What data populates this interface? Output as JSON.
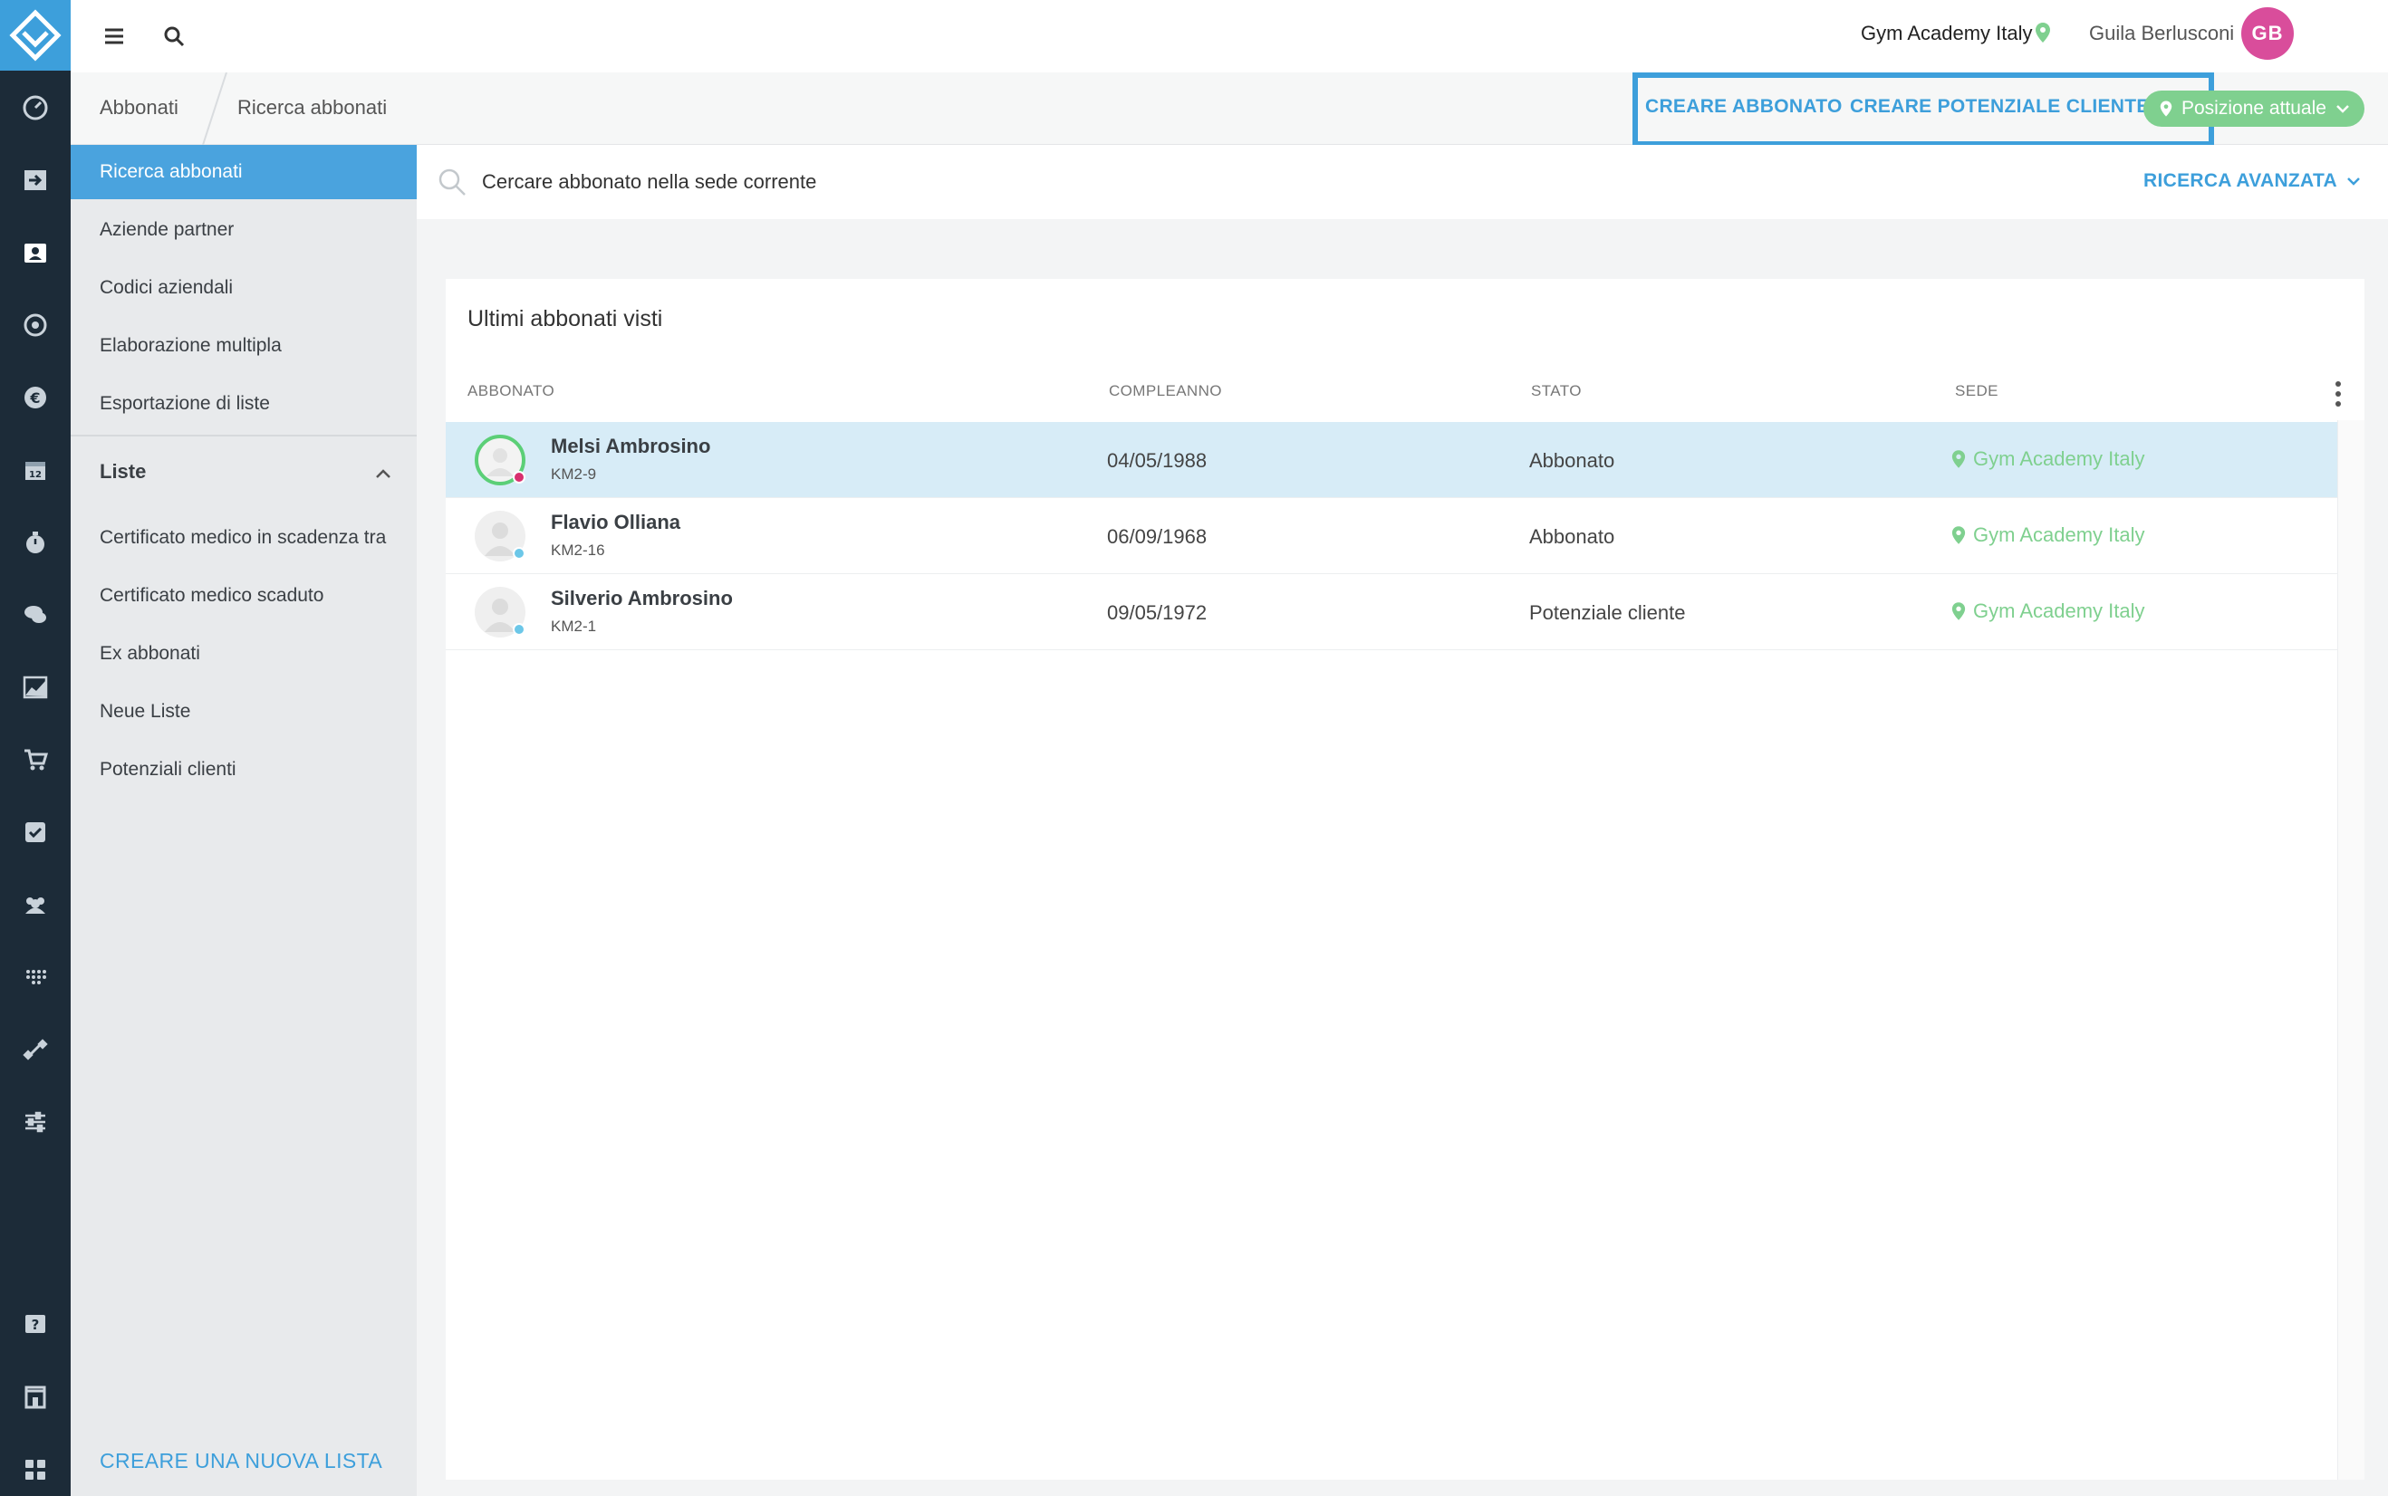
{
  "topbar": {
    "gym_name": "Gym Academy Italy",
    "user_name": "Guila Berlusconi",
    "avatar_initials": "GB"
  },
  "breadcrumb": [
    "Abbonati",
    "Ricerca abbonati"
  ],
  "actions": {
    "create_subscriber": "CREARE ABBONATO",
    "create_lead": "CREARE POTENZIALE CLIENTE",
    "position": "Posizione attuale"
  },
  "sidebar": {
    "items": [
      "Ricerca abbonati",
      "Aziende partner",
      "Codici aziendali",
      "Elaborazione multipla",
      "Esportazione di liste"
    ],
    "lists_heading": "Liste",
    "lists": [
      "Certificato medico in scadenza tra",
      "Certificato medico scaduto",
      "Ex abbonati",
      "Neue Liste",
      "Potenziali clienti"
    ],
    "new_list": "CREARE UNA NUOVA LISTA"
  },
  "search": {
    "placeholder": "Cercare abbonato nella sede corrente",
    "advanced": "RICERCA AVANZATA"
  },
  "panel": {
    "title": "Ultimi abbonati visti",
    "columns": [
      "ABBONATO",
      "COMPLEANNO",
      "STATO",
      "SEDE"
    ],
    "rows": [
      {
        "name": "Melsi Ambrosino",
        "code": "KM2-9",
        "birthday": "04/05/1988",
        "status": "Abbonato",
        "site": "Gym Academy Italy"
      },
      {
        "name": "Flavio Olliana",
        "code": "KM2-16",
        "birthday": "06/09/1968",
        "status": "Abbonato",
        "site": "Gym Academy Italy"
      },
      {
        "name": "Silverio Ambrosino",
        "code": "KM2-1",
        "birthday": "09/05/1972",
        "status": "Potenziale cliente",
        "site": "Gym Academy Italy"
      }
    ]
  },
  "colors": {
    "accent": "#3d9fdb",
    "rail": "#1c2b38",
    "success": "#7fd08f",
    "avatar": "#d94d9b"
  }
}
